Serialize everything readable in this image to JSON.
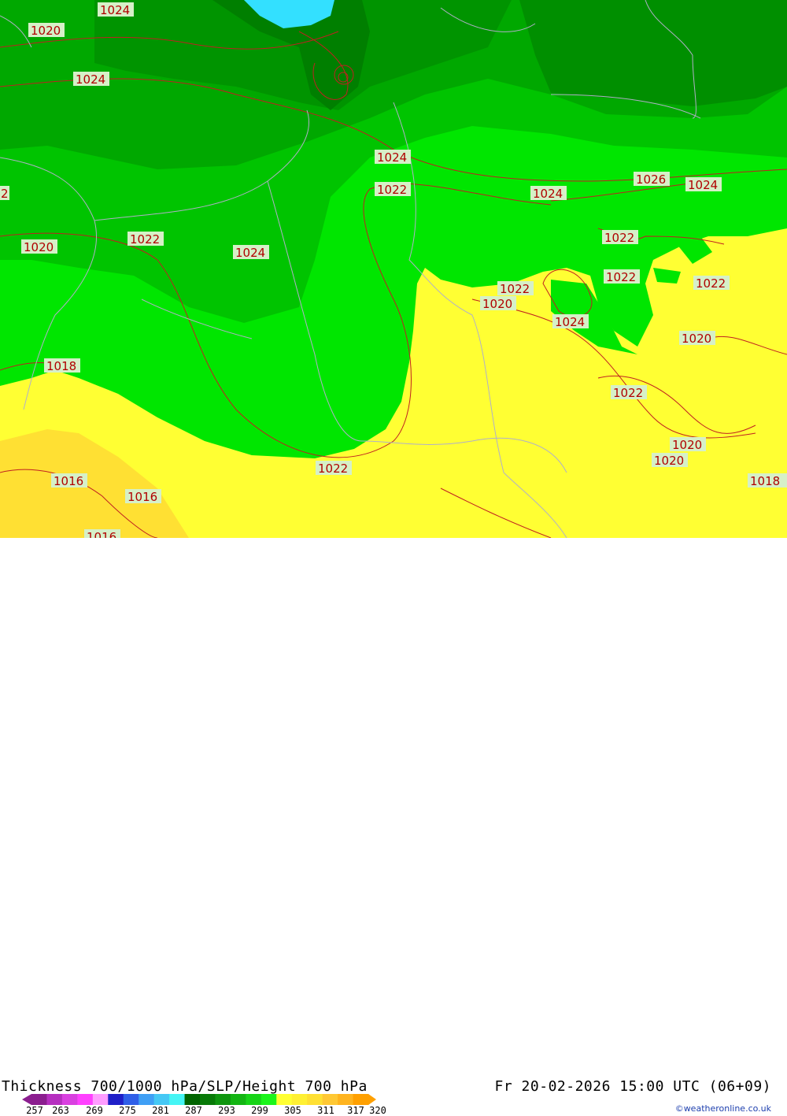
{
  "title": "Thickness 700/1000 hPa/SLP/Height 700 hPa",
  "valid_time": "Fr 20-02-2026 15:00 UTC (06+09)",
  "credit": "©weatheronline.co.uk",
  "legend": {
    "ticks": [
      "257",
      "263",
      "269",
      "275",
      "281",
      "287",
      "293",
      "299",
      "305",
      "311",
      "317",
      "320"
    ],
    "colors": [
      "#8b1e8f",
      "#b62fc0",
      "#d940e0",
      "#ff40ff",
      "#ff9cff",
      "#1f1fc8",
      "#2f5fe8",
      "#3f9ff5",
      "#45c8f5",
      "#45f5f5",
      "#006400",
      "#087a08",
      "#0f960f",
      "#13b513",
      "#17d417",
      "#1af51a",
      "#ffff33",
      "#fff033",
      "#ffe033",
      "#ffc833",
      "#ffb41f",
      "#ffa000"
    ]
  },
  "isobars": [
    "1024",
    "1020",
    "1024",
    "2",
    "1020",
    "1022",
    "1024",
    "1024",
    "1022",
    "1024",
    "1026",
    "1024",
    "1022",
    "1022",
    "1022",
    "1022",
    "1020",
    "1024",
    "1020",
    "1018",
    "1022",
    "1022",
    "1020",
    "1020",
    "1016",
    "1016",
    "1016",
    "1018"
  ]
}
